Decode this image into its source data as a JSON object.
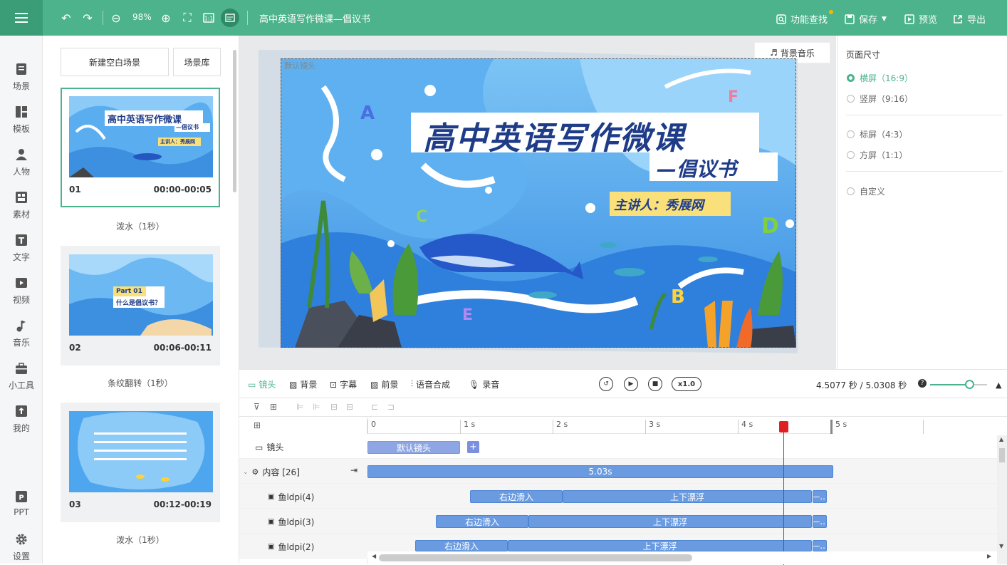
{
  "toolbar": {
    "zoom": "98%",
    "doc_title": "高中英语写作微课—倡议书",
    "find": "功能查找",
    "save": "保存",
    "preview": "预览",
    "export": "导出"
  },
  "nav": [
    {
      "label": "场景"
    },
    {
      "label": "模板"
    },
    {
      "label": "人物"
    },
    {
      "label": "素材"
    },
    {
      "label": "文字"
    },
    {
      "label": "视频"
    },
    {
      "label": "音乐"
    },
    {
      "label": "小工具"
    },
    {
      "label": "我的"
    },
    {
      "label": "PPT"
    },
    {
      "label": "设置"
    }
  ],
  "scene_panel": {
    "new_blank": "新建空白场景",
    "library": "场景库",
    "scenes": [
      {
        "num": "01",
        "time": "00:00-00:05",
        "transition": "泼水（1秒）",
        "title": "高中英语写作微课",
        "subtitle": "—倡议书",
        "speaker": "主讲人：秀展网"
      },
      {
        "num": "02",
        "time": "00:06-00:11",
        "transition": "条纹翻转（1秒）",
        "title": "Part 01",
        "subtitle": "什么是倡议书？"
      },
      {
        "num": "03",
        "time": "00:12-00:19",
        "transition": "泼水（1秒）"
      }
    ]
  },
  "canvas": {
    "music": "背景音乐",
    "default_lens": "默认镜头",
    "title": "高中英语写作微课",
    "subtitle": "—倡议书",
    "speaker": "主讲人：秀展网",
    "letters": [
      "A",
      "F",
      "C",
      "D",
      "E",
      "B"
    ]
  },
  "right_panel": {
    "title": "页面尺寸",
    "options": [
      "横屏（16:9）",
      "竖屏（9:16）",
      "标屏（4:3）",
      "方屏（1:1）",
      "自定义"
    ]
  },
  "timeline": {
    "tabs": [
      "镜头",
      "背景",
      "字幕",
      "前景",
      "语音合成",
      "录音"
    ],
    "speed": "x1.0",
    "time": "4.5077 秒 / 5.0308 秒",
    "ruler": [
      "0",
      "1 s",
      "2 s",
      "3 s",
      "4 s",
      "5 s"
    ],
    "tracks": {
      "lens": "镜头",
      "content": "内容 [26]",
      "fish4": "鱼ldpi(4)",
      "fish3": "鱼ldpi(3)",
      "fish2": "鱼ldpi(2)"
    },
    "clips": {
      "lens": "默认镜头",
      "content": "5.03s",
      "slide_in": "右边滑入",
      "float": "上下漂浮",
      "more": "—..."
    }
  }
}
